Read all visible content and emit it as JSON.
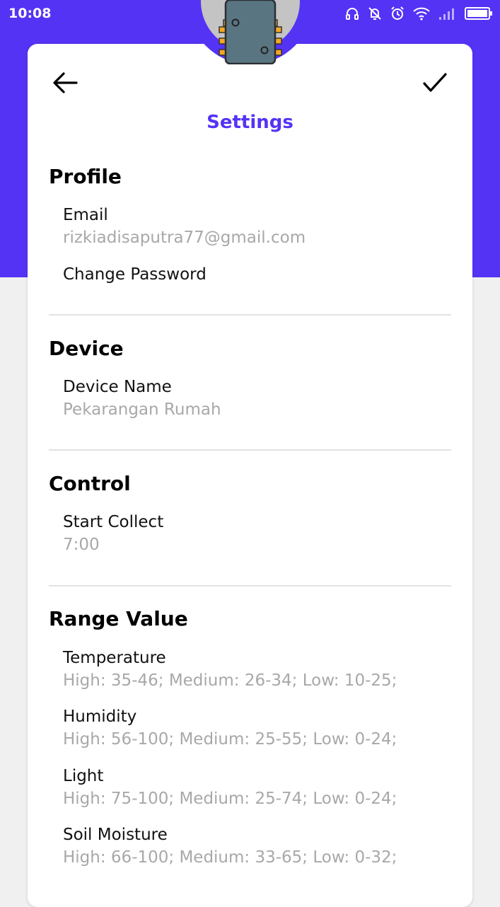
{
  "status_bar": {
    "time": "10:08",
    "icons": [
      "headset-icon",
      "notifications-off-icon",
      "alarm-icon",
      "wifi-icon",
      "signal-icon",
      "battery-icon"
    ]
  },
  "theme": {
    "accent": "#5533f5",
    "muted_text": "#a8a8a8",
    "background": "#f0f0f0"
  },
  "header": {
    "title": "Settings",
    "back_icon": "arrow-left-icon",
    "confirm_icon": "check-icon",
    "avatar_icon": "microchip-icon"
  },
  "profile": {
    "title": "Profile",
    "email_label": "Email",
    "email_value": "rizkiadisaputra77@gmail.com",
    "change_password_label": "Change Password"
  },
  "device": {
    "title": "Device",
    "name_label": "Device Name",
    "name_value": "Pekarangan Rumah"
  },
  "control": {
    "title": "Control",
    "start_collect_label": "Start Collect",
    "start_collect_value": "7:00"
  },
  "range_value": {
    "title": "Range Value",
    "items": [
      {
        "label": "Temperature",
        "value": "High: 35-46; Medium: 26-34; Low: 10-25;"
      },
      {
        "label": "Humidity",
        "value": "High: 56-100; Medium: 25-55; Low: 0-24;"
      },
      {
        "label": "Light",
        "value": "High: 75-100; Medium: 25-74; Low: 0-24;"
      },
      {
        "label": "Soil Moisture",
        "value": "High: 66-100; Medium: 33-65; Low: 0-32;"
      }
    ]
  }
}
